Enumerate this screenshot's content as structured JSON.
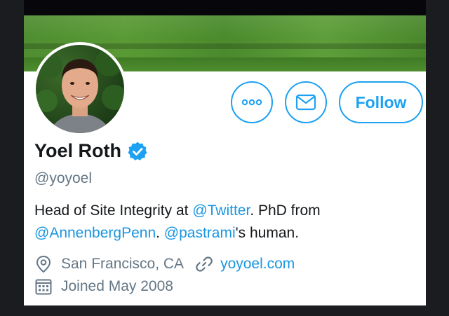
{
  "profile": {
    "name": "Yoel Roth",
    "handle": "@yoyoel",
    "bio": {
      "part1": "Head of Site Integrity at ",
      "mention1": "@Twitter",
      "part2": ". PhD from ",
      "mention2": "@AnnenbergPenn",
      "part3": ". ",
      "mention3": "@pastrami",
      "part4": "'s human."
    },
    "location": "San Francisco, CA",
    "website": "yoyoel.com",
    "joined": "Joined May 2008",
    "verified": true
  },
  "actions": {
    "more_icon": "more-horizontal-icon",
    "message_icon": "envelope-icon",
    "follow_label": "Follow"
  },
  "colors": {
    "accent": "#1da1f2",
    "link": "#1b95e0",
    "secondary_text": "#657786",
    "primary_text": "#14171a"
  }
}
